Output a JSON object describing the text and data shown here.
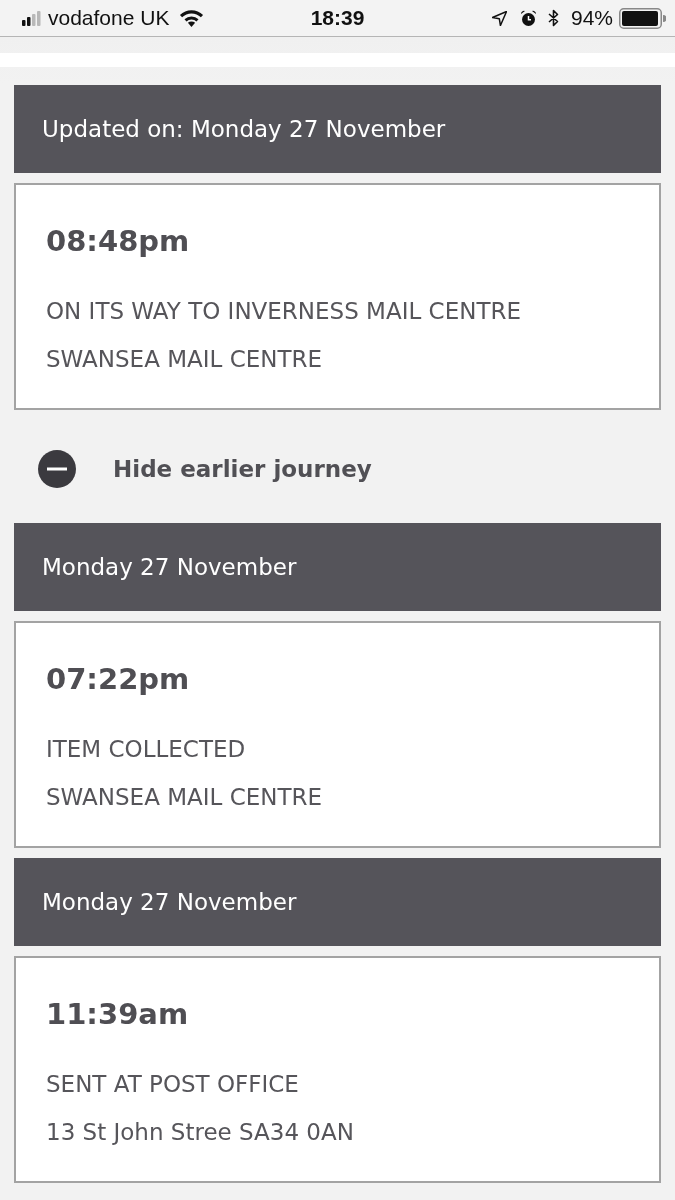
{
  "status_bar": {
    "carrier": "vodafone UK",
    "time": "18:39",
    "battery": "94%"
  },
  "latest": {
    "header": "Updated on: Monday 27 November",
    "time": "08:48pm",
    "status": "ON ITS WAY TO INVERNESS MAIL CENTRE",
    "location": "SWANSEA MAIL CENTRE"
  },
  "toggle": {
    "label": "Hide earlier journey",
    "expanded": true
  },
  "history": [
    {
      "date": "Monday 27 November",
      "time": "07:22pm",
      "status": "ITEM COLLECTED",
      "location": "SWANSEA MAIL CENTRE"
    },
    {
      "date": "Monday 27 November",
      "time": "11:39am",
      "status": "SENT AT POST OFFICE",
      "location": "13 St John Stree SA34 0AN"
    }
  ]
}
